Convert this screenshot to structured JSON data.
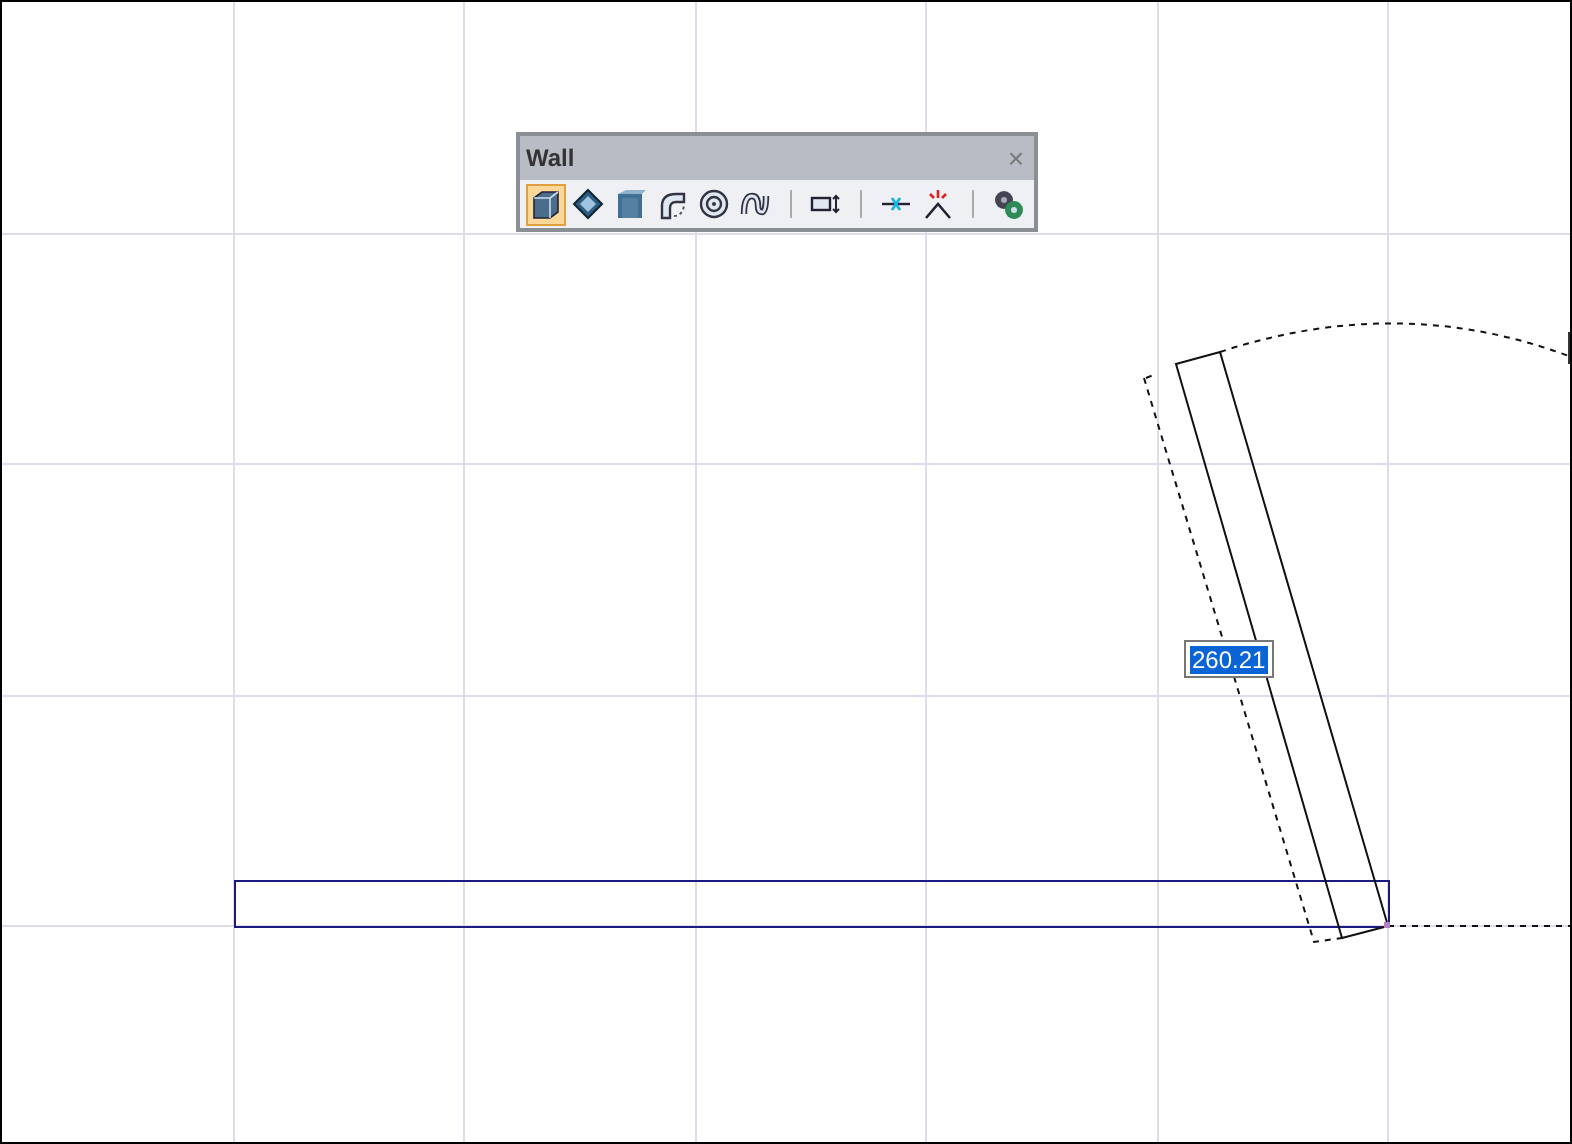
{
  "toolbar": {
    "title": "Wall",
    "close": "×",
    "groups": [
      [
        {
          "kind": "wall",
          "selected": true
        },
        {
          "kind": "slab",
          "selected": false
        },
        {
          "kind": "column",
          "selected": false
        },
        {
          "kind": "arc",
          "selected": false
        },
        {
          "kind": "circle",
          "selected": false
        },
        {
          "kind": "curve",
          "selected": false
        }
      ],
      [
        {
          "kind": "dimension",
          "selected": false
        }
      ],
      [
        {
          "kind": "split",
          "selected": false
        },
        {
          "kind": "trim",
          "selected": false
        }
      ],
      [
        {
          "kind": "settings",
          "selected": false
        }
      ]
    ]
  },
  "length_input": {
    "value": "260.21",
    "text_selected": true
  }
}
